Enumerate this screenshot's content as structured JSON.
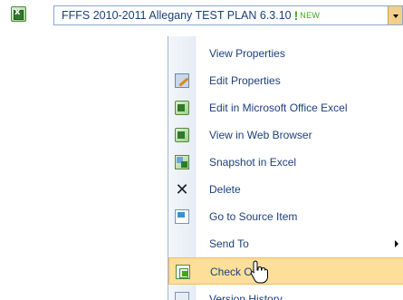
{
  "document": {
    "title": "FFFS 2010-2011 Allegany TEST PLAN 6.3.10",
    "new_mark": "!",
    "new_label": "NEW"
  },
  "menu": {
    "items": [
      {
        "label": "View Properties",
        "icon": "properties-icon"
      },
      {
        "label": "Edit Properties",
        "icon": "edit-properties-icon"
      },
      {
        "label": "Edit in Microsoft Office Excel",
        "icon": "excel-icon"
      },
      {
        "label": "View in Web Browser",
        "icon": "excel-web-icon"
      },
      {
        "label": "Snapshot in Excel",
        "icon": "snapshot-icon"
      },
      {
        "label": "Delete",
        "icon": "delete-icon"
      },
      {
        "label": "Go to Source Item",
        "icon": "source-item-icon"
      },
      {
        "label": "Send To",
        "icon": "send-to-icon",
        "submenu": true
      },
      {
        "label": "Check Out",
        "icon": "check-out-icon",
        "highlighted": true
      },
      {
        "label": "Version History",
        "icon": "version-history-icon"
      }
    ]
  },
  "colors": {
    "highlight": "#fddf99",
    "highlight_border": "#f0be5c",
    "text": "#1c3f7a",
    "new_green": "#3da81e"
  }
}
